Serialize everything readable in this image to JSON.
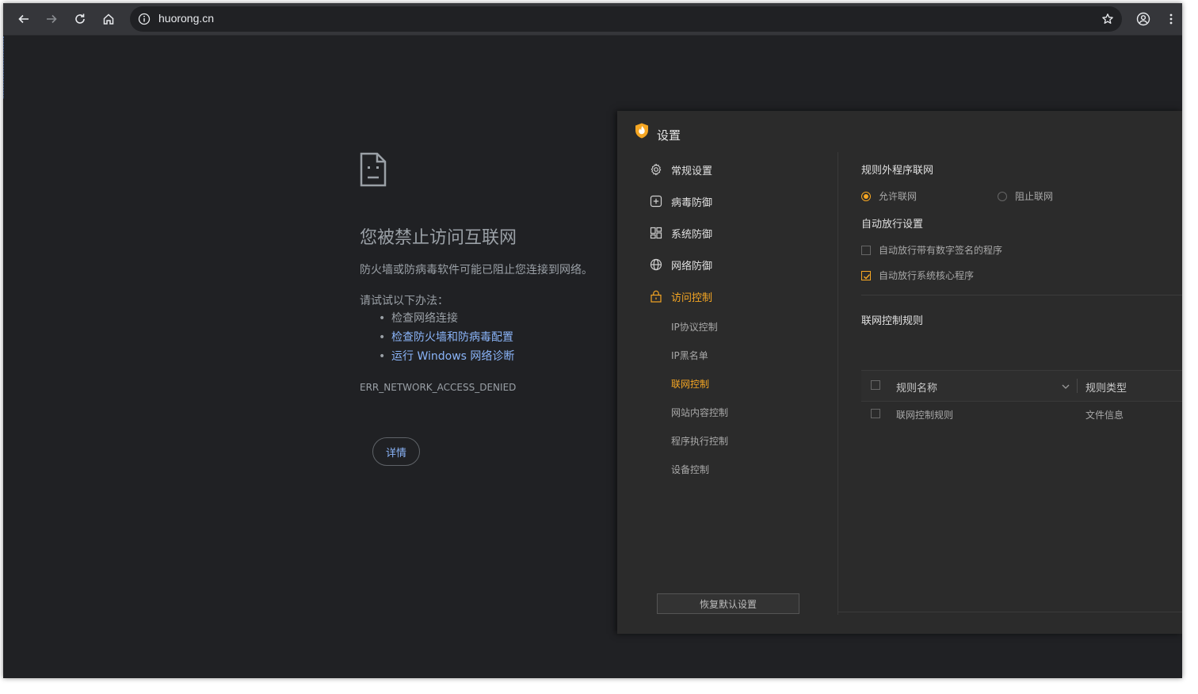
{
  "browser": {
    "url": "huorong.cn",
    "icons": [
      "back-icon",
      "forward-icon",
      "reload-icon",
      "home-icon",
      "site-info-icon",
      "bookmark-star-icon",
      "profile-icon",
      "menu-icon"
    ]
  },
  "error_page": {
    "title": "您被禁止访问互联网",
    "description": "防火墙或防病毒软件可能已阻止您连接到网络。",
    "try_label": "请试试以下办法：",
    "suggestions": [
      "检查网络连接",
      "检查防火墙和防病毒配置",
      "运行 Windows 网络诊断"
    ],
    "error_code": "ERR_NETWORK_ACCESS_DENIED",
    "details_button": "详情"
  },
  "settings": {
    "title": "设置",
    "accent_color": "#f5a623",
    "menu": [
      {
        "label": "常规设置",
        "icon": "gear-icon"
      },
      {
        "label": "病毒防御",
        "icon": "plus-box-icon"
      },
      {
        "label": "系统防御",
        "icon": "grid-icon"
      },
      {
        "label": "网络防御",
        "icon": "globe-icon"
      },
      {
        "label": "访问控制",
        "icon": "lock-icon",
        "active": true
      }
    ],
    "submenu": [
      {
        "label": "IP协议控制"
      },
      {
        "label": "IP黑名单"
      },
      {
        "label": "联网控制",
        "active": true
      },
      {
        "label": "网站内容控制"
      },
      {
        "label": "程序执行控制"
      },
      {
        "label": "设备控制"
      }
    ],
    "restore_button": "恢复默认设置",
    "rule_section_title": "规则外程序联网",
    "radio_allow": "允许联网",
    "radio_block": "阻止联网",
    "auto_section_title": "自动放行设置",
    "check_signed": "自动放行带有数字签名的程序",
    "check_signed_on": false,
    "check_core": "自动放行系统核心程序",
    "check_core_on": true,
    "rules_title": "联网控制规则",
    "table": {
      "col_name": "规则名称",
      "col_type": "规则类型",
      "rows": [
        {
          "name": "联网控制规则",
          "type": "文件信息"
        }
      ]
    }
  }
}
